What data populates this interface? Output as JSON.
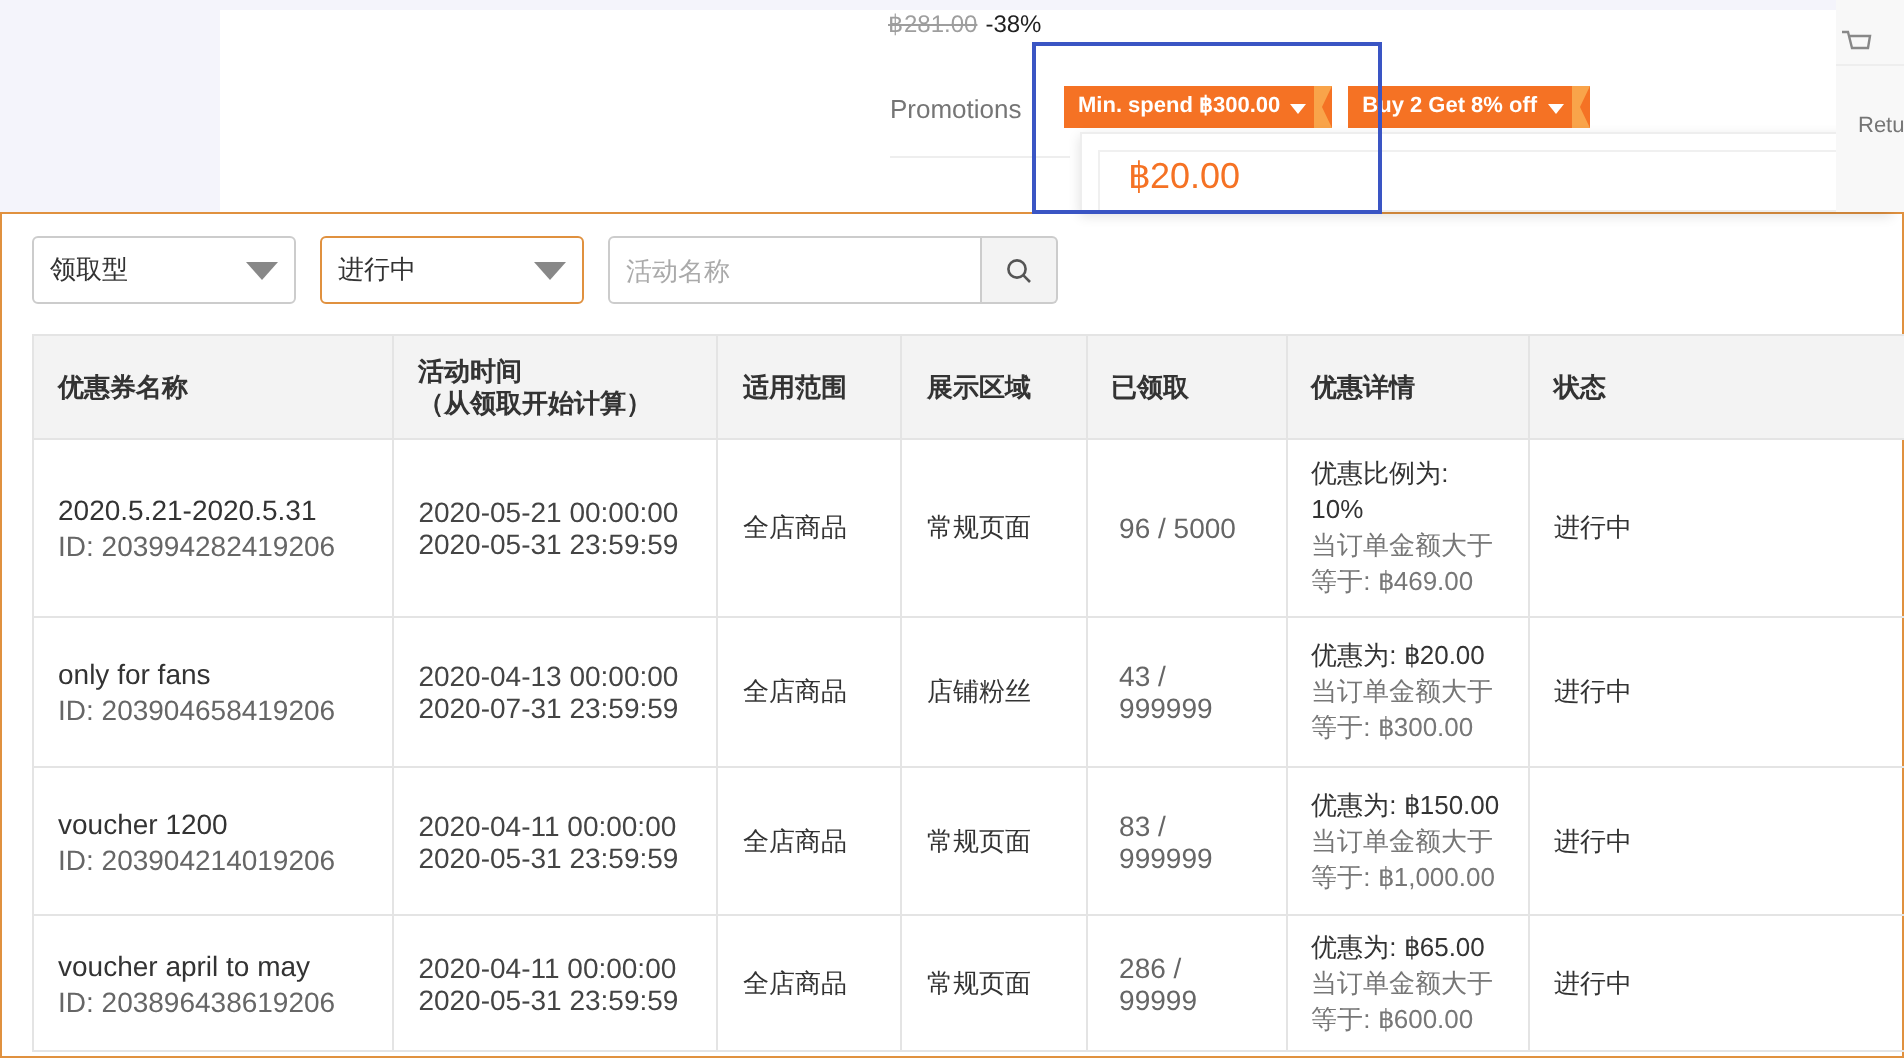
{
  "product": {
    "old_price": "฿281.00",
    "discount": "-38%",
    "promotions_label": "Promotions",
    "promo_tags": [
      {
        "label": "Min. spend ฿300.00"
      },
      {
        "label": "Buy 2 Get 8% off"
      }
    ],
    "popup_amount": "฿20.00",
    "side_label": "Retu"
  },
  "filters": [
    {
      "value": "领取型",
      "focused": false
    },
    {
      "value": "进行中",
      "focused": true
    }
  ],
  "search": {
    "placeholder": "活动名称"
  },
  "table": {
    "columns": [
      "优惠券名称",
      {
        "label": "活动时间",
        "note": "（从领取开始计算）"
      },
      "适用范围",
      "展示区域",
      "已领取",
      "优惠详情",
      "状态"
    ],
    "rows": [
      {
        "name": "2020.5.21-2020.5.31",
        "id": "ID: 203994282419206",
        "time_start": "2020-05-21 00:00:00",
        "time_end": "2020-05-31 23:59:59",
        "scope": "全店商品",
        "display_area": "常规页面",
        "claimed": "96 / 5000",
        "discount": "优惠比例为: 10%",
        "condition": "当订单金额大于等于: ฿469.00",
        "status": "进行中"
      },
      {
        "name": "only for fans",
        "id": "ID: 203904658419206",
        "time_start": "2020-04-13 00:00:00",
        "time_end": "2020-07-31 23:59:59",
        "scope": "全店商品",
        "display_area": "店铺粉丝",
        "claimed": "43 / 999999",
        "discount": "优惠为: ฿20.00",
        "condition": "当订单金额大于等于: ฿300.00",
        "status": "进行中"
      },
      {
        "name": "voucher 1200",
        "id": "ID: 203904214019206",
        "time_start": "2020-04-11 00:00:00",
        "time_end": "2020-05-31 23:59:59",
        "scope": "全店商品",
        "display_area": "常规页面",
        "claimed": "83 / 999999",
        "discount": "优惠为: ฿150.00",
        "condition": "当订单金额大于等于: ฿1,000.00",
        "status": "进行中"
      },
      {
        "name": "voucher april to may",
        "id": "ID: 203896438619206",
        "time_start": "2020-04-11 00:00:00",
        "time_end": "2020-05-31 23:59:59",
        "scope": "全店商品",
        "display_area": "常规页面",
        "claimed": "286 / 99999",
        "discount": "优惠为: ฿65.00",
        "condition": "当订单金额大于等于: ฿600.00",
        "status": "进行中"
      }
    ]
  }
}
